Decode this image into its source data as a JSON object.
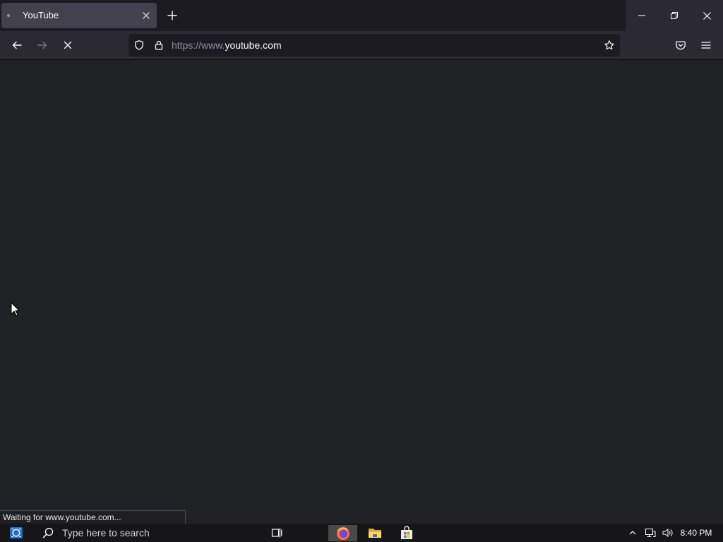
{
  "browser": {
    "tab": {
      "title": "YouTube"
    },
    "url": {
      "prefix": "https://www.",
      "domain": "youtube.com"
    },
    "status_text": "Waiting for www.youtube.com..."
  },
  "taskbar": {
    "search_placeholder": "Type here to search",
    "clock": "8:40 PM"
  },
  "icons": {
    "tab": [
      "loading-dot-icon",
      "tab-close-icon"
    ],
    "new_tab": "plus-icon",
    "window_controls": [
      "minimize-icon",
      "restore-icon",
      "close-icon"
    ],
    "navigation": [
      "back-arrow-icon",
      "forward-arrow-icon",
      "stop-icon"
    ],
    "urlbar": [
      "tracking-shield-icon",
      "lock-icon",
      "bookmark-star-icon"
    ],
    "toolbar_right": [
      "pocket-icon",
      "hamburger-menu-icon"
    ],
    "taskbar": [
      "start-icon",
      "search-icon",
      "task-view-icon",
      "firefox-icon",
      "file-explorer-icon",
      "microsoft-store-icon"
    ],
    "tray": [
      "chevron-up-icon",
      "network-icon",
      "volume-icon"
    ],
    "pointer": "mouse-cursor-icon"
  },
  "colors": {
    "titlebar_bg": "#1c1b22",
    "toolbar_bg": "#2b2a33",
    "tab_active_bg": "#42414d",
    "urlbar_bg": "#1c1b22",
    "content_bg": "#202124",
    "taskbar_bg": "#161618",
    "text_primary": "#fbfbfe",
    "text_muted": "#8f8f9d"
  }
}
